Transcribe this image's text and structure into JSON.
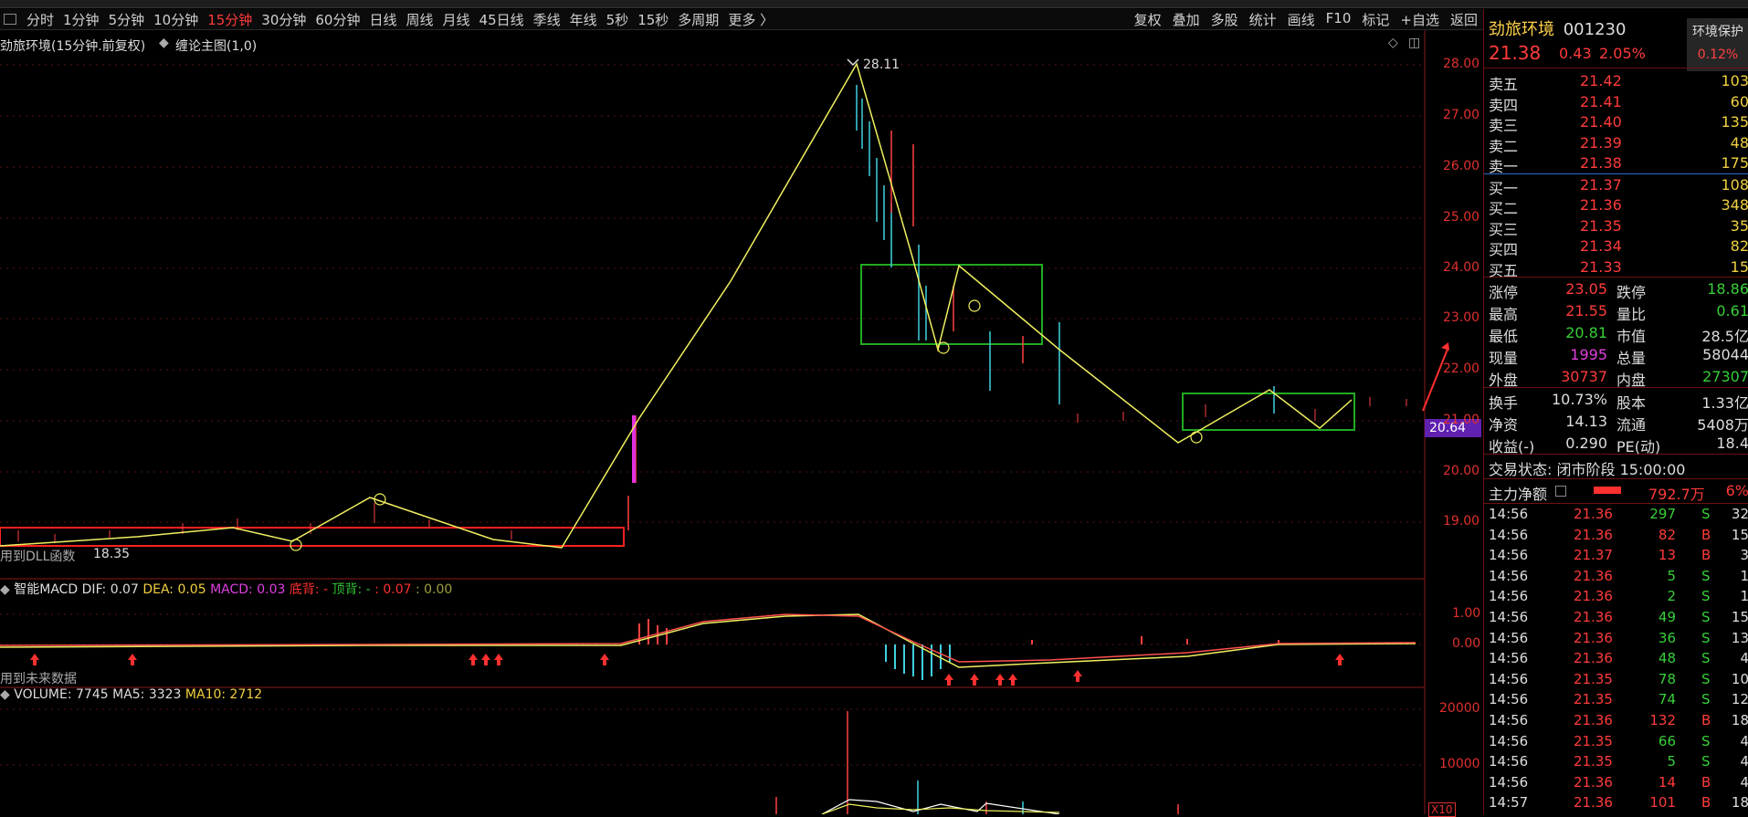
{
  "toolbar": {
    "periods": [
      "分时",
      "1分钟",
      "5分钟",
      "10分钟",
      "15分钟",
      "30分钟",
      "60分钟",
      "日线",
      "周线",
      "月线",
      "45日线",
      "季线",
      "年线",
      "5秒",
      "15秒",
      "多周期",
      "更多 〉"
    ],
    "active_period": "15分钟",
    "tools": [
      "复权",
      "叠加",
      "多股",
      "统计",
      "画线",
      "F10",
      "标记",
      "+自选",
      "返回"
    ]
  },
  "main_chart": {
    "title": "劲旅环境(15分钟.前复权)",
    "indicator": "缠论主图(1,0)",
    "peak_label": "28.11",
    "low_label": "18.35",
    "dll_note": "用到DLL函数",
    "current_price_tag": "20.64",
    "y_ticks": [
      "28.00",
      "27.00",
      "26.00",
      "25.00",
      "24.00",
      "23.00",
      "22.00",
      "21.00",
      "20.00",
      "19.00"
    ]
  },
  "macd": {
    "name": "智能MACD",
    "dif": "DIF: 0.07",
    "dea": "DEA: 0.05",
    "macd": "MACD: 0.03",
    "bottom": "底背: -",
    "top": "顶背: -",
    "v1": ": 0.07",
    "v2": ": 0.00",
    "note": "用到未来数据",
    "y_ticks": [
      "1.00",
      "0.00"
    ]
  },
  "volume": {
    "name": "VOLUME: 7745",
    "ma5": "MA5: 3323",
    "ma10": "MA10: 2712",
    "y_ticks": [
      "20000",
      "10000"
    ],
    "unit": "X10"
  },
  "quote": {
    "name": "劲旅环境",
    "code": "001230",
    "protect_line1": "环境保护",
    "protect_line2": "0.12%",
    "price": "21.38",
    "change": "0.43",
    "pct": "2.05%",
    "asks": [
      {
        "label": "卖五",
        "price": "21.42",
        "vol": "103"
      },
      {
        "label": "卖四",
        "price": "21.41",
        "vol": "60"
      },
      {
        "label": "卖三",
        "price": "21.40",
        "vol": "135"
      },
      {
        "label": "卖二",
        "price": "21.39",
        "vol": "48"
      },
      {
        "label": "卖一",
        "price": "21.38",
        "vol": "175"
      }
    ],
    "bids": [
      {
        "label": "买一",
        "price": "21.37",
        "vol": "108"
      },
      {
        "label": "买二",
        "price": "21.36",
        "vol": "348"
      },
      {
        "label": "买三",
        "price": "21.35",
        "vol": "35"
      },
      {
        "label": "买四",
        "price": "21.34",
        "vol": "82"
      },
      {
        "label": "买五",
        "price": "21.33",
        "vol": "15"
      }
    ],
    "stats1": [
      {
        "l1": "涨停",
        "v1": "23.05",
        "l2": "跌停",
        "v2": "18.86"
      },
      {
        "l1": "最高",
        "v1": "21.55",
        "l2": "量比",
        "v2": "0.61"
      },
      {
        "l1": "最低",
        "v1": "20.81",
        "l2": "市值",
        "v2": "28.5亿"
      },
      {
        "l1": "现量",
        "v1": "1995",
        "l2": "总量",
        "v2": "58044"
      },
      {
        "l1": "外盘",
        "v1": "30737",
        "l2": "内盘",
        "v2": "27307"
      }
    ],
    "stats2": [
      {
        "l1": "换手",
        "v1": "10.73%",
        "l2": "股本",
        "v2": "1.33亿"
      },
      {
        "l1": "净资",
        "v1": "14.13",
        "l2": "流通",
        "v2": "5408万"
      },
      {
        "l1": "收益(-)",
        "v1": "0.290",
        "l2": "PE(动)",
        "v2": "18.4"
      }
    ],
    "trade_status": "交易状态: 闭市阶段 15:00:00",
    "main_net_label": "主力净额",
    "main_net_value": "792.7万",
    "main_net_pct": "6%",
    "trades": [
      {
        "t": "14:56",
        "p": "21.36",
        "v": "297",
        "s": "S",
        "n": "32"
      },
      {
        "t": "14:56",
        "p": "21.36",
        "v": "82",
        "s": "B",
        "n": "15"
      },
      {
        "t": "14:56",
        "p": "21.37",
        "v": "13",
        "s": "B",
        "n": "3"
      },
      {
        "t": "14:56",
        "p": "21.36",
        "v": "5",
        "s": "S",
        "n": "1"
      },
      {
        "t": "14:56",
        "p": "21.36",
        "v": "2",
        "s": "S",
        "n": "1"
      },
      {
        "t": "14:56",
        "p": "21.36",
        "v": "49",
        "s": "S",
        "n": "15"
      },
      {
        "t": "14:56",
        "p": "21.36",
        "v": "36",
        "s": "S",
        "n": "13"
      },
      {
        "t": "14:56",
        "p": "21.36",
        "v": "48",
        "s": "S",
        "n": "4"
      },
      {
        "t": "14:56",
        "p": "21.35",
        "v": "78",
        "s": "S",
        "n": "10"
      },
      {
        "t": "14:56",
        "p": "21.35",
        "v": "74",
        "s": "S",
        "n": "12"
      },
      {
        "t": "14:56",
        "p": "21.36",
        "v": "132",
        "s": "B",
        "n": "18"
      },
      {
        "t": "14:56",
        "p": "21.35",
        "v": "66",
        "s": "S",
        "n": "4"
      },
      {
        "t": "14:56",
        "p": "21.35",
        "v": "5",
        "s": "S",
        "n": "4"
      },
      {
        "t": "14:56",
        "p": "21.36",
        "v": "14",
        "s": "B",
        "n": "4"
      },
      {
        "t": "14:57",
        "p": "21.36",
        "v": "101",
        "s": "B",
        "n": "18"
      }
    ]
  }
}
